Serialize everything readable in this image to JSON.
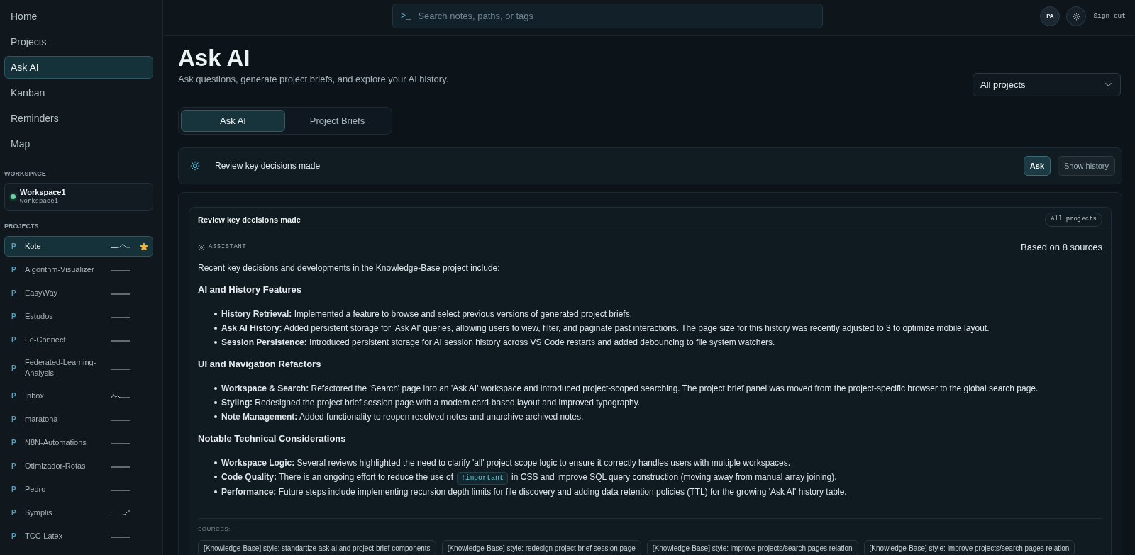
{
  "sidebar": {
    "nav": [
      {
        "label": "Home",
        "selected": false
      },
      {
        "label": "Projects",
        "selected": false
      },
      {
        "label": "Ask AI",
        "selected": true
      },
      {
        "label": "Kanban",
        "selected": false
      },
      {
        "label": "Reminders",
        "selected": false
      },
      {
        "label": "Map",
        "selected": false
      }
    ],
    "workspace_heading": "WORKSPACE",
    "workspace": {
      "name": "Workspace1",
      "slug": "workspace1"
    },
    "projects_heading": "PROJECTS",
    "projects": [
      {
        "badge": "P",
        "name": "Kote",
        "kind": "bump",
        "starred": true,
        "selected": true
      },
      {
        "badge": "P",
        "name": "Algorithm-Visualizer",
        "kind": "flat",
        "starred": false,
        "selected": false
      },
      {
        "badge": "P",
        "name": "EasyWay",
        "kind": "flat",
        "starred": false,
        "selected": false
      },
      {
        "badge": "P",
        "name": "Estudos",
        "kind": "flat",
        "starred": false,
        "selected": false
      },
      {
        "badge": "P",
        "name": "Fe-Connect",
        "kind": "flat",
        "starred": false,
        "selected": false
      },
      {
        "badge": "P",
        "name": "Federated-Learning-Analysis",
        "kind": "flat",
        "starred": false,
        "selected": false
      },
      {
        "badge": "P",
        "name": "Inbox",
        "kind": "wave",
        "starred": false,
        "selected": false
      },
      {
        "badge": "P",
        "name": "maratona",
        "kind": "flat",
        "starred": false,
        "selected": false
      },
      {
        "badge": "P",
        "name": "N8N-Automations",
        "kind": "flat",
        "starred": false,
        "selected": false
      },
      {
        "badge": "P",
        "name": "Otimizador-Rotas",
        "kind": "flat",
        "starred": false,
        "selected": false
      },
      {
        "badge": "P",
        "name": "Pedro",
        "kind": "flat",
        "starred": false,
        "selected": false
      },
      {
        "badge": "P",
        "name": "Symplis",
        "kind": "step",
        "starred": false,
        "selected": false
      },
      {
        "badge": "P",
        "name": "TCC-Latex",
        "kind": "flat",
        "starred": false,
        "selected": false
      }
    ]
  },
  "topbar": {
    "search": {
      "prompt": ">_",
      "placeholder": "Search notes, paths, or tags"
    },
    "avatar": "PA",
    "sign_out": "Sign out"
  },
  "header": {
    "title": "Ask AI",
    "subtitle": "Ask questions, generate project briefs, and explore your AI history.",
    "scope": "All projects"
  },
  "tabs": [
    {
      "label": "Ask AI",
      "selected": true
    },
    {
      "label": "Project Briefs",
      "selected": false
    }
  ],
  "ask_bar": {
    "value": "Review key decisions made",
    "buttons": [
      {
        "label": "Ask",
        "kind": "primary"
      },
      {
        "label": "Show history",
        "kind": "secondary"
      }
    ]
  },
  "answer": {
    "title": "Review key decisions made",
    "scope": "All projects",
    "role": "ASSISTANT",
    "source_count": "Based on 8 sources",
    "intro": "Recent key decisions and developments in the Knowledge-Base project include:",
    "sections": [
      {
        "heading": "AI and History Features",
        "bullets": [
          {
            "segments": [
              {
                "kind": "text",
                "text": "**History Retrieval:** Implemented a feature to browse and select previous versions of generated project briefs."
              }
            ]
          },
          {
            "segments": [
              {
                "kind": "text",
                "text": "**Ask AI History:** Added persistent storage for 'Ask AI' queries, allowing users to view, filter, and paginate past interactions. The page size for this history was recently adjusted to 3 to optimize mobile layout."
              }
            ]
          },
          {
            "segments": [
              {
                "kind": "text",
                "text": "**Session Persistence:** Introduced persistent storage for AI session history across VS Code restarts and added debouncing to file system watchers."
              }
            ]
          }
        ]
      },
      {
        "heading": "UI and Navigation Refactors",
        "bullets": [
          {
            "segments": [
              {
                "kind": "text",
                "text": "**Workspace & Search:** Refactored the 'Search' page into an 'Ask AI' workspace and introduced project-scoped searching. The project brief panel was moved from the project-specific browser to the global search page."
              }
            ]
          },
          {
            "segments": [
              {
                "kind": "text",
                "text": "**Styling:** Redesigned the project brief session page with a modern card-based layout and improved typography."
              }
            ]
          },
          {
            "segments": [
              {
                "kind": "text",
                "text": "**Note Management:** Added functionality to reopen resolved notes and unarchive archived notes."
              }
            ]
          }
        ]
      },
      {
        "heading": "Notable Technical Considerations",
        "bullets": [
          {
            "segments": [
              {
                "kind": "text",
                "text": "**Workspace Logic:** Several reviews highlighted the need to clarify 'all' project scope logic to ensure it correctly handles users with multiple workspaces."
              }
            ]
          },
          {
            "segments": [
              {
                "kind": "text",
                "text": "**Code Quality:** There is an ongoing effort to reduce the use of"
              },
              {
                "kind": "code",
                "text": "!important"
              },
              {
                "kind": "text",
                "text": "in CSS and improve SQL query construction (moving away from manual array joining)."
              }
            ]
          },
          {
            "segments": [
              {
                "kind": "text",
                "text": "**Performance:** Future steps include implementing recursion depth limits for file discovery and adding data retention policies (TTL) for the growing 'Ask AI' history table."
              }
            ]
          }
        ]
      }
    ],
    "sources_label": "SOURCES:",
    "sources": [
      "[Knowledge-Base] style: standartize ask ai and project brief components",
      "[Knowledge-Base] style: redesign project brief session page",
      "[Knowledge-Base] style: improve projects/search pages relation",
      "[Knowledge-Base] style: improve projects/search pages relation"
    ]
  }
}
